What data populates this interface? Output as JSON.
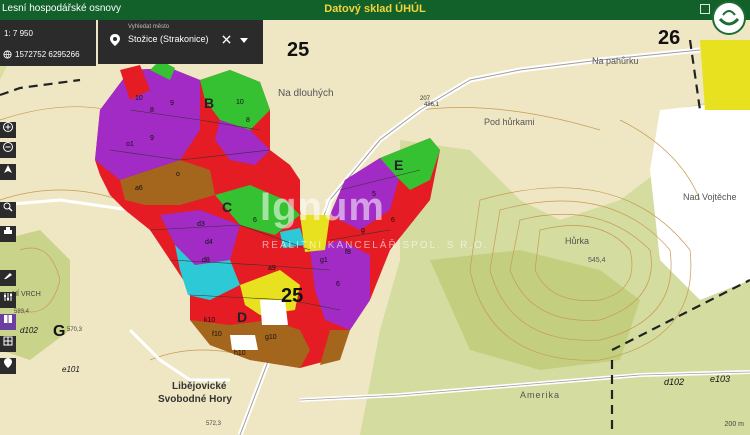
{
  "topbar": {
    "app_title": "Lesní hospodářské osnovy",
    "center_title": "Datový sklad ÚHÚL"
  },
  "info": {
    "scale": "1: 7 950",
    "coordinates": "1572752 6295266"
  },
  "search": {
    "placeholder": "Vyhledat město",
    "value": "Stožice (Strakonice)"
  },
  "map_labels": {
    "grid_25_top": "25",
    "grid_26": "26",
    "grid_25_center": "25",
    "na_pahurku": "Na pahůrku",
    "na_dlouhych": "Na dlouhých",
    "pod_hurkami": "Pod hůrkami",
    "nad_vojteche": "Nad Vojtěche",
    "hurka": "Hůrka",
    "elev_545": "545,4",
    "elev_583": "583,4",
    "elev_570": "570,3",
    "elev_572": "572,3",
    "elev_486": "486,1",
    "elev_207": "207",
    "ni_vrch": "NÍ VRCH",
    "g_big": "G",
    "letter_b": "B",
    "letter_c": "C",
    "letter_d": "D",
    "letter_e": "E",
    "d102_left": "d102",
    "e101": "e101",
    "libejovicke": "Libějovické",
    "svobodne_hory": "Svobodné Hory",
    "amerika": "Amerika",
    "d102_right": "d102",
    "e103": "e103",
    "scale_label": "200 m"
  },
  "watermark": {
    "main": "Ignum",
    "sub": "REALITNÍ KANCELÁŘ SPOL. S R.O."
  },
  "colors": {
    "topbar": "#12612b",
    "panel": "#2b2b2b",
    "forest_red": "#e51c23",
    "forest_green": "#35c132",
    "forest_purple": "#a12bc4",
    "forest_brown": "#a4661c",
    "forest_cyan": "#2ec9d6",
    "forest_yellow": "#e8e11f",
    "meadow": "#efe7c4",
    "woodland": "#d4dca0"
  }
}
